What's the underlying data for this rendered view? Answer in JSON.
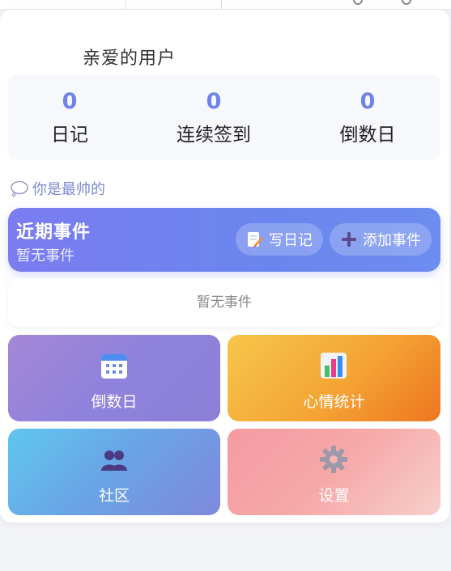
{
  "greeting": "亲爱的用户",
  "stats": [
    {
      "value": "0",
      "label": "日记"
    },
    {
      "value": "0",
      "label": "连续签到"
    },
    {
      "value": "0",
      "label": "倒数日"
    }
  ],
  "motto": "你是最帅的",
  "events": {
    "title": "近期事件",
    "subtitle": "暂无事件",
    "write_diary": "写日记",
    "add_event": "添加事件",
    "empty_text": "暂无事件"
  },
  "tiles": [
    {
      "label": "倒数日",
      "icon": "calendar-icon"
    },
    {
      "label": "心情统计",
      "icon": "bar-chart-icon"
    },
    {
      "label": "社区",
      "icon": "people-icon"
    },
    {
      "label": "设置",
      "icon": "gear-icon"
    }
  ],
  "colors": {
    "accent": "#7083e6",
    "events_bar": "#6f82ef",
    "tile_countdown": "#9585d9",
    "tile_mood": "#f4a434",
    "tile_community": "#6aa3e6",
    "tile_settings": "#f6a9a9"
  }
}
